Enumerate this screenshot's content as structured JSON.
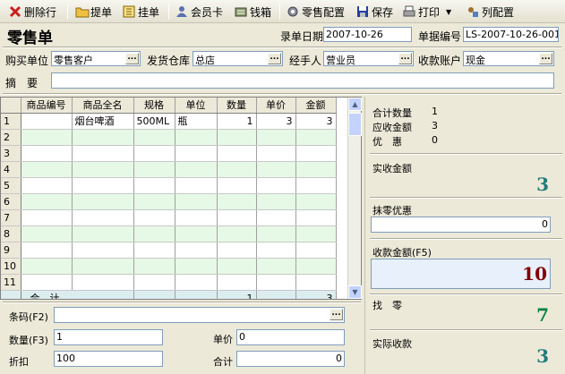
{
  "toolbar": {
    "delete_row": "删除行",
    "fetch_bill": "提单",
    "hang_bill": "挂单",
    "member_card": "会员卡",
    "cash_box": "钱箱",
    "retail_config": "零售配置",
    "save": "保存",
    "print": "打印",
    "column_config": "列配置"
  },
  "form": {
    "title": "零售单",
    "entry_date_label": "录单日期",
    "entry_date": "2007-10-26",
    "bill_no_label": "单据编号",
    "bill_no": "LS-2007-10-26-001",
    "buyer_label": "购买单位",
    "buyer": "零售客户",
    "warehouse_label": "发货仓库",
    "warehouse": "总店",
    "handler_label": "经手人",
    "handler": "营业员",
    "account_label": "收款账户",
    "account": "现金",
    "summary_label": "摘　要",
    "summary": ""
  },
  "grid": {
    "columns": [
      "商品编号",
      "商品全名",
      "规格",
      "单位",
      "数量",
      "单价",
      "金额"
    ],
    "rows": [
      {
        "n": "1",
        "code": "",
        "name": "烟台啤酒",
        "spec": "500ML",
        "unit": "瓶",
        "qty": "1",
        "price": "3",
        "amount": "3"
      },
      {
        "n": "2"
      },
      {
        "n": "3"
      },
      {
        "n": "4"
      },
      {
        "n": "5"
      },
      {
        "n": "6"
      },
      {
        "n": "7"
      },
      {
        "n": "8"
      },
      {
        "n": "9"
      },
      {
        "n": "10"
      },
      {
        "n": "11"
      }
    ],
    "footer": {
      "label": "合　计",
      "qty": "1",
      "amount": "3"
    }
  },
  "entry": {
    "barcode_label": "条码(F2)",
    "barcode": "",
    "qty_label": "数量(F3)",
    "qty": "1",
    "price_label": "单价",
    "price": "0",
    "discount_label": "折扣",
    "discount": "100",
    "total_label": "合计",
    "total": "0"
  },
  "summary_panel": {
    "total_qty_label": "合计数量",
    "total_qty": "1",
    "receivable_label": "应收金额",
    "receivable": "3",
    "discount_label": "优　惠",
    "discount": "0",
    "actual_amount_label": "实收金额",
    "actual_amount": "3",
    "rounding_label": "抹零优惠",
    "rounding": "0",
    "received_label": "收款金额(F5)",
    "received": "10",
    "change_label": "找　零",
    "change": "7",
    "actual_received_label": "实际收款",
    "actual_received": "3"
  },
  "colors": {
    "row_alt": "#e6f9e6",
    "big_teal": "#1e7c7c",
    "big_red": "#800000",
    "big_green": "#008040"
  }
}
